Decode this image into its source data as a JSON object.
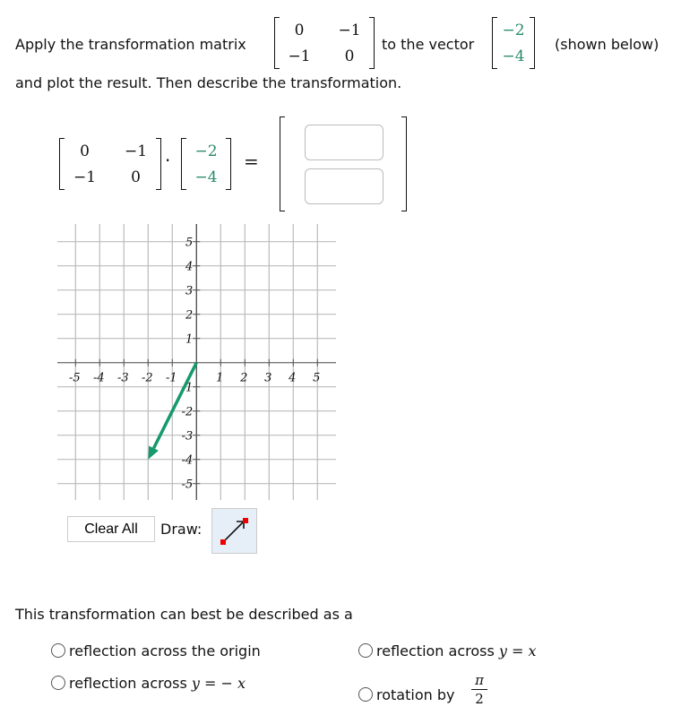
{
  "question": {
    "prefix": "Apply the transformation matrix",
    "mid": "to the vector",
    "suffix": "(shown below)",
    "line2": "and plot the result. Then describe the transformation.",
    "matrix": [
      [
        "0",
        "−1"
      ],
      [
        "−1",
        "0"
      ]
    ],
    "vector": [
      "−2",
      "−4"
    ]
  },
  "equation": {
    "dot": "·",
    "equals": "=",
    "answer_values": [
      "",
      ""
    ]
  },
  "graph": {
    "x_ticks": [
      "-5",
      "-4",
      "-3",
      "-2",
      "-1",
      "1",
      "2",
      "3",
      "4",
      "5"
    ],
    "y_ticks": [
      "5",
      "4",
      "3",
      "2",
      "1",
      "-1",
      "-2",
      "-3",
      "-4",
      "-5"
    ],
    "vector_tip": [
      -2,
      -4
    ],
    "vector_color": "#16996e"
  },
  "controls": {
    "clear_all": "Clear All",
    "draw_label": "Draw:",
    "draw_tool_icon": "vector-arrow-icon"
  },
  "choices": {
    "prompt": "This transformation can best be described as a",
    "options": [
      {
        "text": "reflection across the origin"
      },
      {
        "text": "reflection across ",
        "math": "y = x"
      },
      {
        "text": "reflection across ",
        "math": "y = − x"
      },
      {
        "text": "rotation by ",
        "num": "π",
        "den": "2"
      }
    ]
  }
}
